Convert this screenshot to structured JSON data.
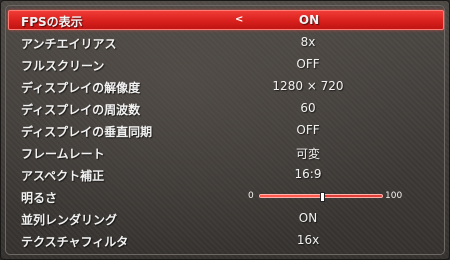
{
  "settings": [
    {
      "label": "FPSの表示",
      "value": "ON",
      "selected": true
    },
    {
      "label": "アンチエイリアス",
      "value": "8x"
    },
    {
      "label": "フルスクリーン",
      "value": "OFF"
    },
    {
      "label": "ディスプレイの解像度",
      "value": "1280 × 720"
    },
    {
      "label": "ディスプレイの周波数",
      "value": "60"
    },
    {
      "label": "ディスプレイの垂直同期",
      "value": "OFF"
    },
    {
      "label": "フレームレート",
      "value": "可変"
    },
    {
      "label": "アスペクト補正",
      "value": "16:9"
    },
    {
      "label": "明るさ",
      "slider": {
        "min": "0",
        "max": "100",
        "value": 50
      }
    },
    {
      "label": "並列レンダリング",
      "value": "ON"
    },
    {
      "label": "テクスチャフィルタ",
      "value": "16x"
    }
  ],
  "selected_arrow": "<",
  "colors": {
    "highlight": "#d9201d",
    "text": "#f2f2f2"
  }
}
